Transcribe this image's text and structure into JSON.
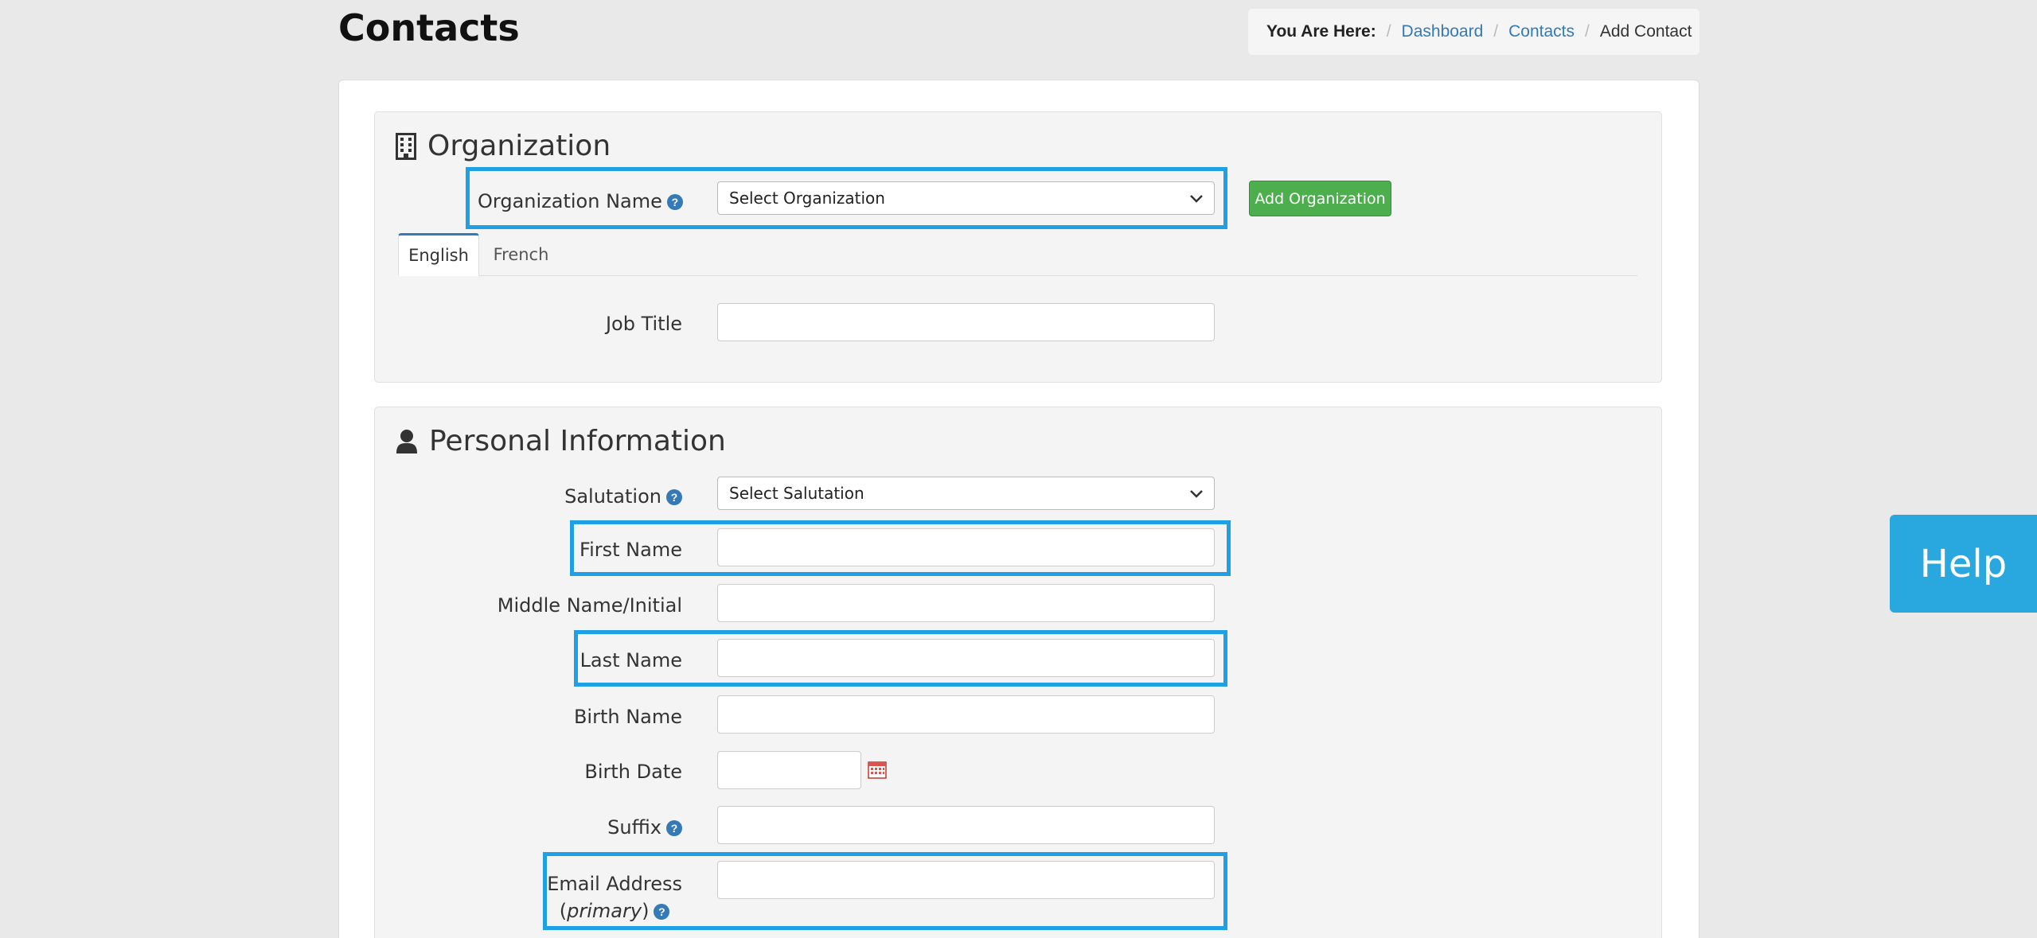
{
  "page": {
    "title": "Contacts"
  },
  "breadcrumb": {
    "lead": "You Are Here:",
    "items": [
      "Dashboard",
      "Contacts"
    ],
    "current": "Add Contact"
  },
  "organization": {
    "heading": "Organization",
    "org_name_label": "Organization Name",
    "org_select_value": "Select Organization",
    "add_button": "Add Organization",
    "tabs": [
      "English",
      "French"
    ],
    "job_title_label": "Job Title",
    "job_title_value": ""
  },
  "personal": {
    "heading": "Personal Information",
    "salutation_label": "Salutation",
    "salutation_value": "Select Salutation",
    "first_name_label": "First Name",
    "middle_name_label": "Middle Name/Initial",
    "last_name_label": "Last Name",
    "birth_name_label": "Birth Name",
    "birth_date_label": "Birth Date",
    "suffix_label": "Suffix",
    "email_label_line1": "Email Address",
    "email_label_primary": "primary"
  },
  "help": {
    "label": "Help",
    "question_mark": "?"
  },
  "colors": {
    "accent": "#1ea0e6",
    "help_tab": "#29a8e0",
    "add_button": "#4cae4c",
    "link": "#337ab7"
  },
  "icons": [
    "building-icon",
    "user-icon",
    "question-icon",
    "chevron-down-icon",
    "calendar-icon"
  ]
}
